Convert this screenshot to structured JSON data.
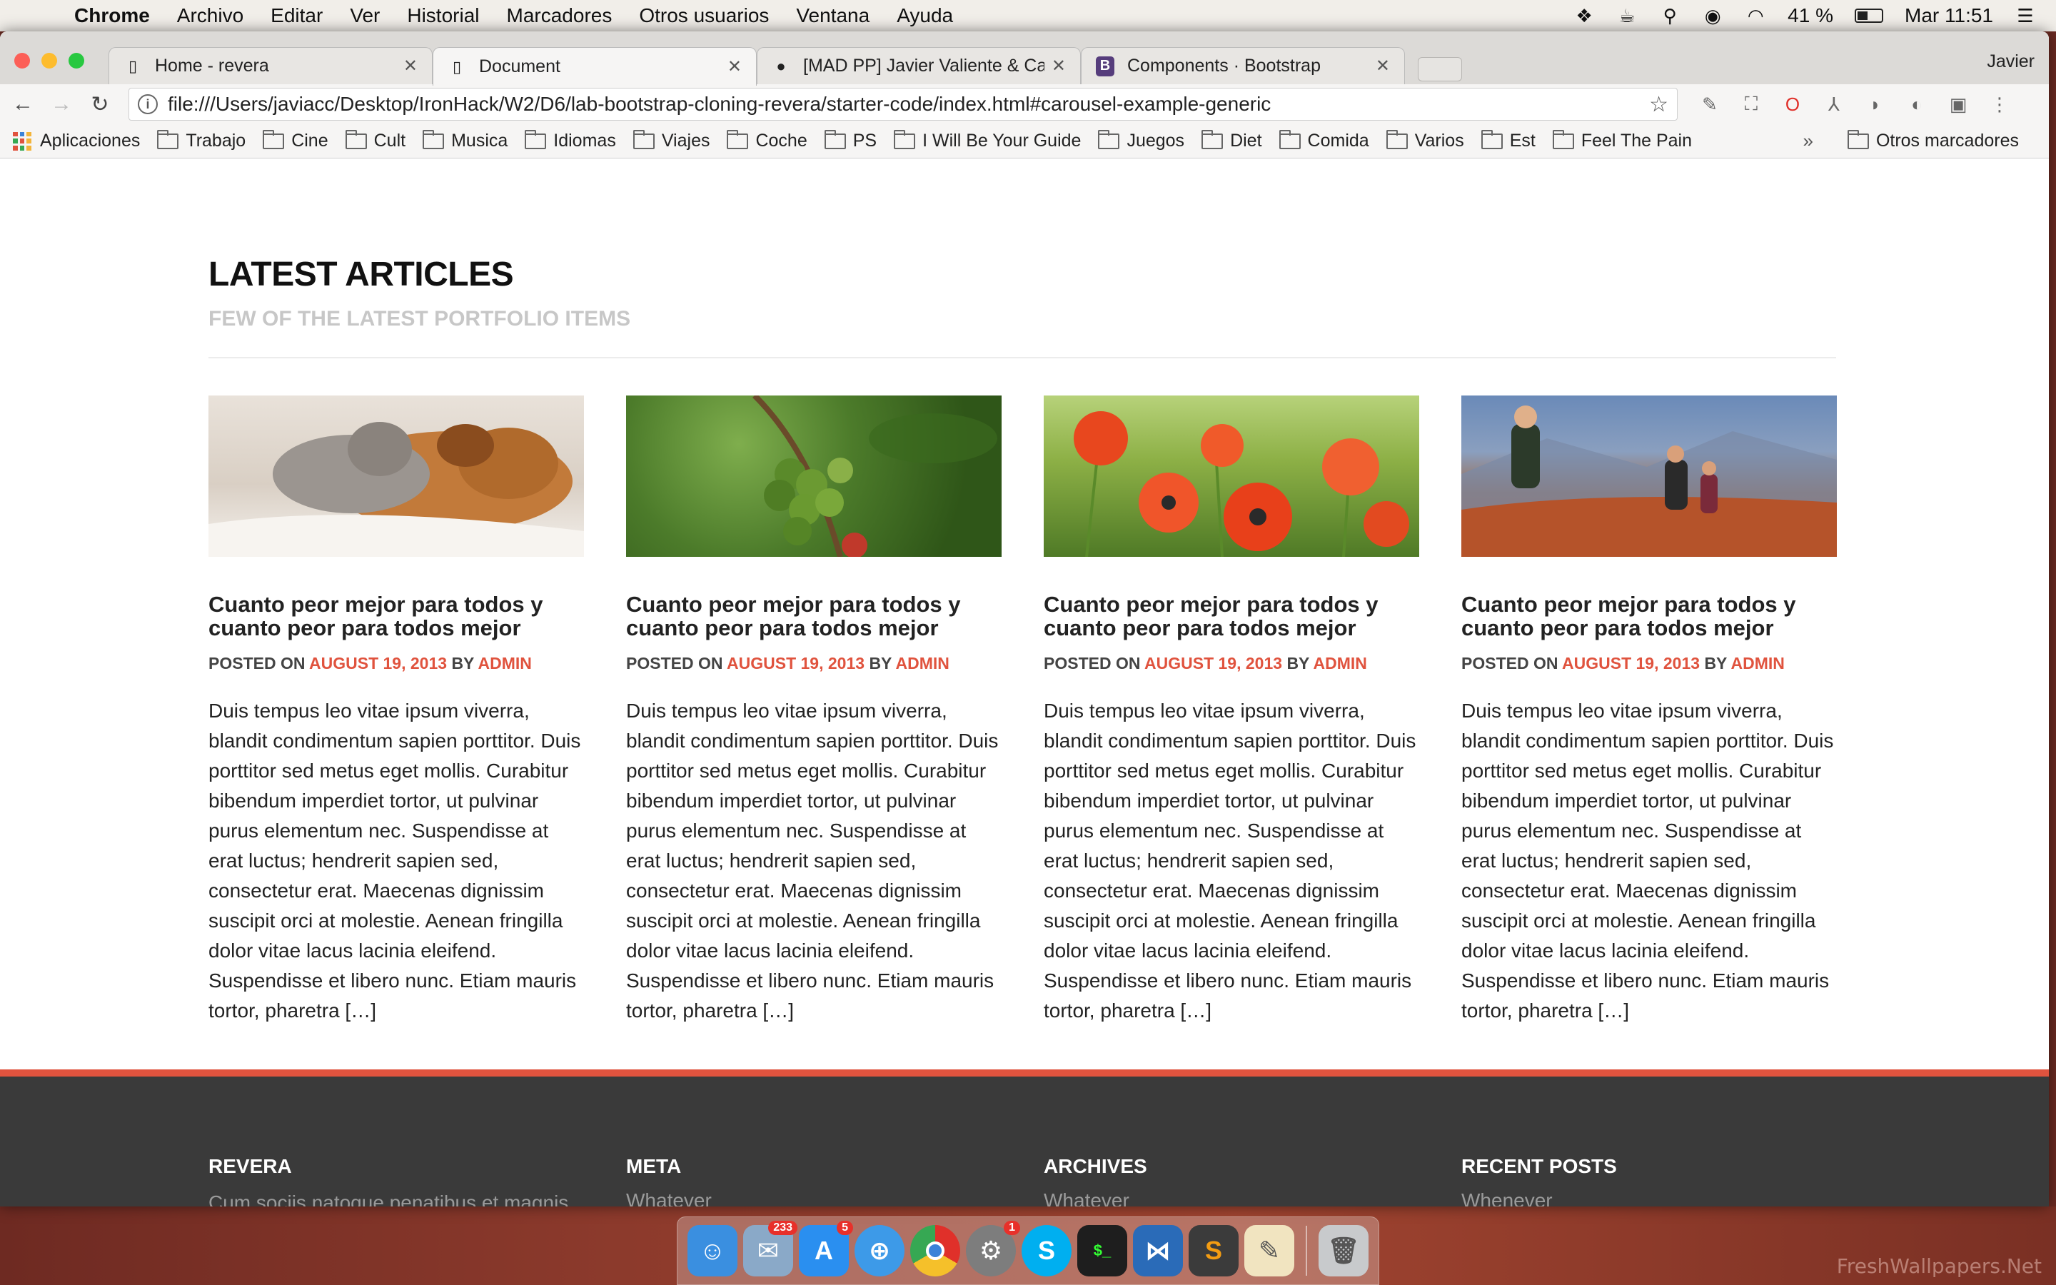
{
  "menubar": {
    "app_name": "Chrome",
    "items": [
      "Archivo",
      "Editar",
      "Ver",
      "Historial",
      "Marcadores",
      "Otros usuarios",
      "Ventana",
      "Ayuda"
    ],
    "battery": "41 %",
    "clock": "Mar 11:51"
  },
  "browser": {
    "tabs": [
      {
        "title": "Home - revera"
      },
      {
        "title": "Document"
      },
      {
        "title": "[MAD PP] Javier Valiente & Ca"
      },
      {
        "title": "Components · Bootstrap"
      }
    ],
    "profile": "Javier",
    "url": "file:///Users/javiacc/Desktop/IronHack/W2/D6/lab-bootstrap-cloning-revera/starter-code/index.html#carousel-example-generic",
    "bookmarks": [
      "Aplicaciones",
      "Trabajo",
      "Cine",
      "Cult",
      "Musica",
      "Idiomas",
      "Viajes",
      "Coche",
      "PS",
      "I Will Be Your Guide",
      "Juegos",
      "Diet",
      "Comida",
      "Varios",
      "Est",
      "Feel The Pain"
    ],
    "bookmarks_more": "»",
    "other_bookmarks": "Otros marcadores"
  },
  "section": {
    "title": "LATEST ARTICLES",
    "subtitle": "FEW OF THE LATEST PORTFOLIO ITEMS"
  },
  "articles": [
    {
      "image": "kitten-puppy-photo",
      "title": "Cuanto peor mejor para todos y cuanto peor para todos mejor",
      "posted_on": "POSTED ON",
      "date": "AUGUST 19, 2013",
      "by": "BY",
      "author": "ADMIN",
      "excerpt": "Duis tempus leo vitae ipsum viverra, blandit condimentum sapien porttitor. Duis porttitor sed metus eget mollis. Curabitur bibendum imperdiet tortor, ut pulvinar purus elementum nec. Suspendisse at erat luctus; hendrerit sapien sed, consectetur erat. Maecenas dignissim suscipit orci at molestie. Aenean fringilla dolor vitae lacus lacinia eleifend. Suspendisse et libero nunc. Etiam mauris tortor, pharetra […]"
    },
    {
      "image": "coffee-beans-photo",
      "title": "Cuanto peor mejor para todos y cuanto peor para todos mejor",
      "posted_on": "POSTED ON",
      "date": "AUGUST 19, 2013",
      "by": "BY",
      "author": "ADMIN",
      "excerpt": "Duis tempus leo vitae ipsum viverra, blandit condimentum sapien porttitor. Duis porttitor sed metus eget mollis. Curabitur bibendum imperdiet tortor, ut pulvinar purus elementum nec. Suspendisse at erat luctus; hendrerit sapien sed, consectetur erat. Maecenas dignissim suscipit orci at molestie. Aenean fringilla dolor vitae lacus lacinia eleifend. Suspendisse et libero nunc. Etiam mauris tortor, pharetra […]"
    },
    {
      "image": "poppies-photo",
      "title": "Cuanto peor mejor para todos y cuanto peor para todos mejor",
      "posted_on": "POSTED ON",
      "date": "AUGUST 19, 2013",
      "by": "BY",
      "author": "ADMIN",
      "excerpt": "Duis tempus leo vitae ipsum viverra, blandit condimentum sapien porttitor. Duis porttitor sed metus eget mollis. Curabitur bibendum imperdiet tortor, ut pulvinar purus elementum nec. Suspendisse at erat luctus; hendrerit sapien sed, consectetur erat. Maecenas dignissim suscipit orci at molestie. Aenean fringilla dolor vitae lacus lacinia eleifend. Suspendisse et libero nunc. Etiam mauris tortor, pharetra […]"
    },
    {
      "image": "hikers-photo",
      "title": "Cuanto peor mejor para todos y cuanto peor para todos mejor",
      "posted_on": "POSTED ON",
      "date": "AUGUST 19, 2013",
      "by": "BY",
      "author": "ADMIN",
      "excerpt": "Duis tempus leo vitae ipsum viverra, blandit condimentum sapien porttitor. Duis porttitor sed metus eget mollis. Curabitur bibendum imperdiet tortor, ut pulvinar purus elementum nec. Suspendisse at erat luctus; hendrerit sapien sed, consectetur erat. Maecenas dignissim suscipit orci at molestie. Aenean fringilla dolor vitae lacus lacinia eleifend. Suspendisse et libero nunc. Etiam mauris tortor, pharetra […]"
    }
  ],
  "footer": {
    "revera": {
      "title": "REVERA",
      "text": "Cum sociis natoque penatibus et magnis dis parturient montes, nascetur ridiculus"
    },
    "meta": {
      "title": "META",
      "link": "Whatever"
    },
    "archives": {
      "title": "ARCHIVES",
      "link": "Whatever"
    },
    "recent": {
      "title": "RECENT POSTS",
      "link": "Whenever"
    }
  },
  "dock": {
    "apps": [
      {
        "icon": "finder-icon",
        "color": "#3a8fe0"
      },
      {
        "icon": "mail-icon",
        "color": "#8aa9c8",
        "badge": "233"
      },
      {
        "icon": "app-store-icon",
        "color": "#2a8ff0",
        "badge": "5"
      },
      {
        "icon": "safari-icon",
        "color": "#3d9ae8"
      },
      {
        "icon": "chrome-icon",
        "color": "#e8e8e8"
      },
      {
        "icon": "system-preferences-icon",
        "color": "#7d7d7d",
        "badge": "1"
      },
      {
        "icon": "skype-icon",
        "color": "#00aff0"
      },
      {
        "icon": "terminal-icon",
        "color": "#1e1e1e"
      },
      {
        "icon": "vscode-icon",
        "color": "#2a6bb8"
      },
      {
        "icon": "sublime-text-icon",
        "color": "#3b3b3b"
      },
      {
        "icon": "textedit-icon",
        "color": "#f1e4c0"
      },
      {
        "icon": "trash-icon",
        "color": "#c8cacc"
      }
    ]
  },
  "watermark": "FreshWallpapers.Net",
  "colors": {
    "accent": "#e0533e",
    "footer_bg": "#3a3a3a"
  }
}
